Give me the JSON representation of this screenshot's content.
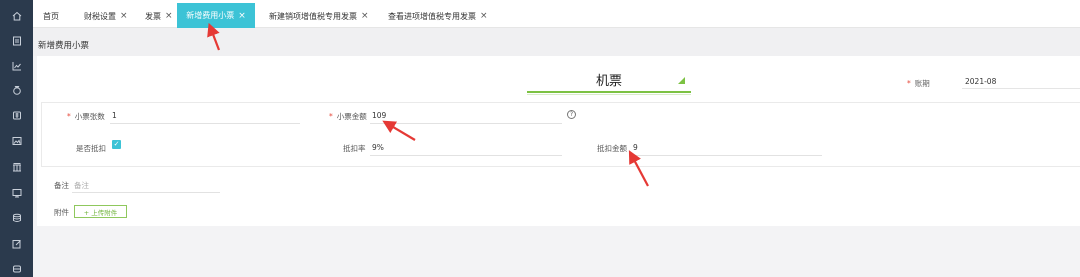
{
  "sidebar": {
    "icons": [
      "home-icon",
      "document-icon",
      "chart-icon",
      "money-bag-icon",
      "coin-icon",
      "image-icon",
      "building-icon",
      "monitor-icon",
      "database-icon",
      "edit-icon",
      "grid-icon"
    ]
  },
  "tabs": [
    {
      "label": "首页",
      "closable": false
    },
    {
      "label": "财税设置",
      "closable": true
    },
    {
      "label": "发票",
      "closable": true
    },
    {
      "label": "新增费用小票",
      "closable": true,
      "active": true
    },
    {
      "label": "新建销项增值税专用发票",
      "closable": true
    },
    {
      "label": "查看进项增值税专用发票",
      "closable": true
    }
  ],
  "close_glyph": "×",
  "page": {
    "title": "新增费用小票"
  },
  "ticket": {
    "title": "机票"
  },
  "period": {
    "required_mark": "*",
    "label": "账期",
    "value": "2021-08"
  },
  "fields": {
    "count": {
      "required_mark": "*",
      "label": "小票张数",
      "value": "1"
    },
    "amount": {
      "required_mark": "*",
      "label": "小票金额",
      "value": "109"
    },
    "deductible": {
      "label": "是否抵扣",
      "checked": true,
      "check_glyph": "✓"
    },
    "rate": {
      "label": "抵扣率",
      "value": "9%"
    },
    "deduct_amount": {
      "label": "抵扣金额",
      "value": "9"
    },
    "note": {
      "label": "备注",
      "placeholder": "备注"
    },
    "attachment": {
      "label": "附件",
      "button": "+ 上传附件"
    }
  },
  "help_glyph": "?",
  "colors": {
    "accent": "#3cc3d6",
    "sidebar": "#2b3a4d",
    "green": "#7cc243",
    "required": "#e64a3c",
    "arrow": "#e53935"
  }
}
